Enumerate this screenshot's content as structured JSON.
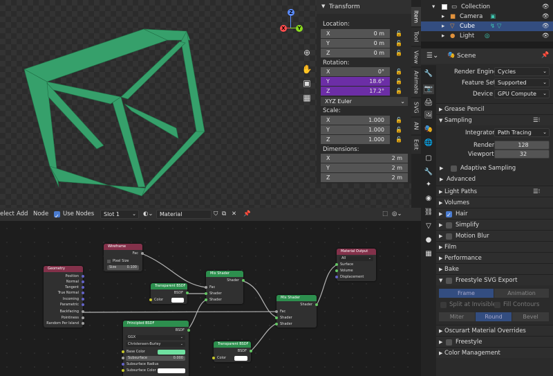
{
  "viewport": {
    "gizmo": {
      "z": "Z",
      "y": "Y",
      "x": "X"
    },
    "tool_icons": [
      "zoom-icon",
      "hand-icon",
      "camera-icon",
      "grid-icon"
    ]
  },
  "transform": {
    "title": "Transform",
    "location_label": "Location:",
    "location": [
      {
        "axis": "X",
        "value": "0 m"
      },
      {
        "axis": "Y",
        "value": "0 m"
      },
      {
        "axis": "Z",
        "value": "0 m"
      }
    ],
    "rotation_label": "Rotation:",
    "rotation": [
      {
        "axis": "X",
        "value": "0°"
      },
      {
        "axis": "Y",
        "value": "18.6°"
      },
      {
        "axis": "Z",
        "value": "17.2°"
      }
    ],
    "rotation_mode": "XYZ Euler",
    "scale_label": "Scale:",
    "scale": [
      {
        "axis": "X",
        "value": "1.000"
      },
      {
        "axis": "Y",
        "value": "1.000"
      },
      {
        "axis": "Z",
        "value": "1.000"
      }
    ],
    "dimensions_label": "Dimensions:",
    "dimensions": [
      {
        "axis": "X",
        "value": "2 m"
      },
      {
        "axis": "Y",
        "value": "2 m"
      },
      {
        "axis": "Z",
        "value": "2 m"
      }
    ]
  },
  "side_tabs": [
    "Item",
    "Tool",
    "View",
    "Animate",
    "SVG",
    "AN",
    "Edit"
  ],
  "outliner": {
    "items": [
      {
        "label": "Collection"
      },
      {
        "label": "Camera"
      },
      {
        "label": "Cube"
      },
      {
        "label": "Light"
      }
    ]
  },
  "properties": {
    "scene_label": "Scene",
    "render_engine_label": "Render Engine",
    "render_engine": "Cycles",
    "feature_set_label": "Feature Set",
    "feature_set": "Supported",
    "device_label": "Device",
    "device": "GPU Compute",
    "grease_pencil": "Grease Pencil",
    "sampling": "Sampling",
    "integrator_label": "Integrator",
    "integrator": "Path Tracing",
    "render_label": "Render",
    "render_value": "128",
    "viewport_label": "Viewport",
    "viewport_value": "32",
    "adaptive_sampling": "Adaptive Sampling",
    "advanced": "Advanced",
    "light_paths": "Light Paths",
    "volumes": "Volumes",
    "hair": "Hair",
    "simplify": "Simplify",
    "motion_blur": "Motion Blur",
    "film": "Film",
    "performance": "Performance",
    "bake": "Bake",
    "freestyle_svg": "Freestyle SVG Export",
    "frame": "Frame",
    "animation": "Animation",
    "split_invisible": "Split at Invisible",
    "fill_contours": "Fill Contours",
    "miter": "Miter",
    "round": "Round",
    "bevel": "Bevel",
    "oscurart": "Oscurart Material Overrides",
    "freestyle": "Freestyle",
    "color_management": "Color Management"
  },
  "node_header": {
    "select": "elect",
    "add": "Add",
    "node": "Node",
    "use_nodes": "Use Nodes",
    "slot": "Slot 1",
    "material": "Material"
  },
  "nodes": {
    "wireframe": {
      "title": "Wireframe",
      "fac": "Fac",
      "pixel_size": "Pixel Size",
      "size_label": "Size",
      "size": "0.100"
    },
    "geometry": {
      "title": "Geometry",
      "outputs": [
        "Position",
        "Normal",
        "Tangent",
        "True Normal",
        "Incoming",
        "Parametric",
        "Backfacing",
        "Pointiness",
        "Random Per Island"
      ]
    },
    "transparent1": {
      "title": "Transparent BSDF",
      "out": "BSDF",
      "color": "Color"
    },
    "mix1": {
      "title": "Mix Shader",
      "out": "Shader",
      "fac": "Fac",
      "s1": "Shader",
      "s2": "Shader"
    },
    "mix2": {
      "title": "Mix Shader",
      "out": "Shader",
      "fac": "Fac",
      "s1": "Shader",
      "s2": "Shader"
    },
    "output": {
      "title": "Material Output",
      "target": "All",
      "surface": "Surface",
      "volume": "Volume",
      "displacement": "Displacement"
    },
    "principled": {
      "title": "Principled BSDF",
      "out": "BSDF",
      "dist": "GGX",
      "sss": "Christensen-Burley",
      "base_color": "Base Color",
      "subsurface": "Subsurface",
      "subsurface_val": "0.000",
      "subsurface_radius": "Subsurface Radius",
      "subsurface_color": "Subsurface Color"
    },
    "transparent2": {
      "title": "Transparent BSDF",
      "out": "BSDF",
      "color": "Color"
    }
  },
  "colors": {
    "cube": "#3aa06a",
    "accent": "#4a7cd1",
    "selection": "#6c2ea6"
  }
}
